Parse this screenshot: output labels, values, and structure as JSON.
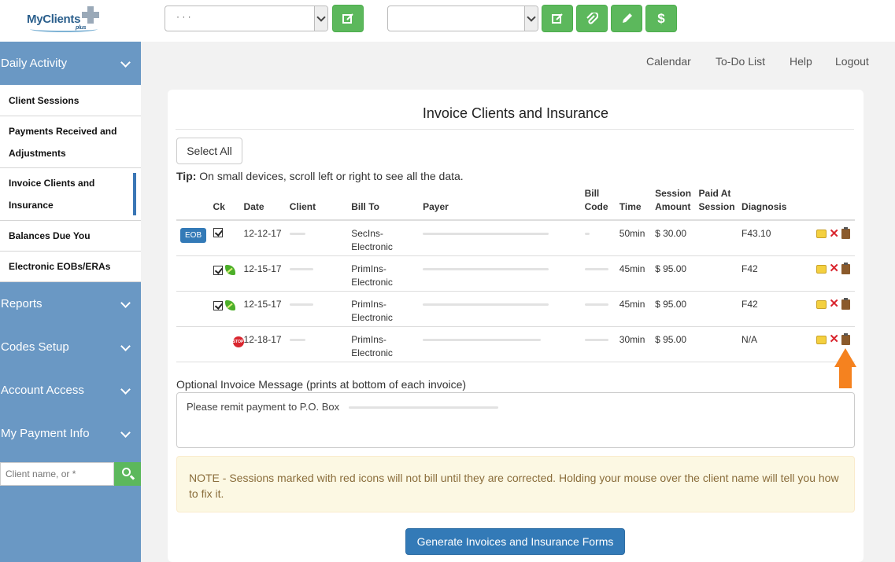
{
  "logo": {
    "text": "MyClients",
    "sub": "plus"
  },
  "toolbar": {
    "select1_value": "· · ·",
    "select2_value": "",
    "dollar_label": "$"
  },
  "nav": {
    "calendar": "Calendar",
    "todo": "To-Do List",
    "help": "Help",
    "logout": "Logout"
  },
  "sidebar": {
    "daily_activity": "Daily Activity",
    "items": [
      {
        "label": "Client Sessions"
      },
      {
        "label": "Payments Received and Adjustments"
      },
      {
        "label": "Invoice Clients and Insurance"
      },
      {
        "label": "Balances Due You"
      },
      {
        "label": "Electronic EOBs/ERAs"
      }
    ],
    "reports": "Reports",
    "codes_setup": "Codes Setup",
    "account_access": "Account Access",
    "my_payment_info": "My Payment Info",
    "search_placeholder": "Client name, or *"
  },
  "page": {
    "title": "Invoice Clients and Insurance",
    "select_all": "Select All",
    "tip_label": "Tip:",
    "tip_text": " On small devices, scroll left or right to see all the data.",
    "columns": {
      "ck": "Ck",
      "date": "Date",
      "client": "Client",
      "bill_to": "Bill To",
      "payer": "Payer",
      "bill_code": "Bill Code",
      "time": "Time",
      "session_amount": "Session Amount",
      "paid_at_session": "Paid At Session",
      "diagnosis": "Diagnosis"
    },
    "rows": [
      {
        "badge": "EOB",
        "date": "12-12-17",
        "bill_to": "SecIns-Electronic",
        "time": "50min",
        "amount": "$ 30.00",
        "diagnosis": "F43.10"
      },
      {
        "badge": "",
        "date": "12-15-17",
        "bill_to": "PrimIns-Electronic",
        "time": "45min",
        "amount": "$ 95.00",
        "diagnosis": "F42"
      },
      {
        "badge": "",
        "date": "12-15-17",
        "bill_to": "PrimIns-Electronic",
        "time": "45min",
        "amount": "$ 95.00",
        "diagnosis": "F42"
      },
      {
        "badge": "",
        "date": "12-18-17",
        "bill_to": "PrimIns-Electronic",
        "time": "30min",
        "amount": "$ 95.00",
        "diagnosis": "N/A"
      }
    ],
    "message_label": "Optional Invoice Message (prints at bottom of each invoice)",
    "message_value": "Please remit payment to P.O. Box",
    "note": "NOTE - Sessions marked with red icons will not bill until they are corrected. Holding your mouse over the client name will tell you how to fix it.",
    "generate_button": "Generate Invoices and Insurance Forms"
  },
  "colors": {
    "sidebar": "#6a98c4",
    "green": "#5cb85c",
    "primary": "#337ab7",
    "arrow": "#f5821f"
  }
}
